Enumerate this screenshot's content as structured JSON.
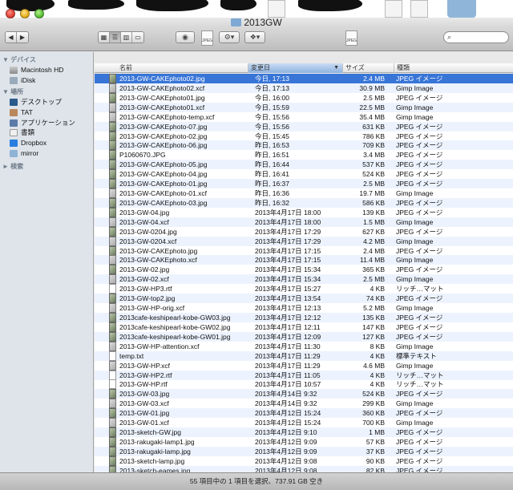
{
  "window": {
    "title": "2013GW"
  },
  "toolbar": {
    "back_icon": "back-arrow-icon",
    "forward_icon": "forward-arrow-icon",
    "view_modes": [
      "icon-view",
      "list-view",
      "column-view",
      "coverflow-view"
    ],
    "selected_view": "list-view",
    "doc_badge": "JPEG"
  },
  "sidebar": {
    "sections": [
      {
        "title": "▼ デバイス",
        "items": [
          {
            "label": "Macintosh HD",
            "icon": "hard-disk-icon"
          },
          {
            "label": "iDisk",
            "icon": "idisk-icon"
          }
        ]
      },
      {
        "title": "▼ 場所",
        "items": [
          {
            "label": "デスクトップ",
            "icon": "desktop-icon"
          },
          {
            "label": "TAT",
            "icon": "home-icon"
          },
          {
            "label": "アプリケーション",
            "icon": "applications-icon"
          },
          {
            "label": "書類",
            "icon": "documents-icon"
          },
          {
            "label": "Dropbox",
            "icon": "dropbox-icon"
          },
          {
            "label": "mirror",
            "icon": "folder-icon"
          }
        ]
      },
      {
        "title": "► 検索",
        "items": []
      }
    ]
  },
  "columns": {
    "name": "名前",
    "date": "変更日",
    "size": "サイズ",
    "kind": "種類",
    "sort_arrow": "▼"
  },
  "files": [
    {
      "name": "2013-GW-CAKEphoto02.jpg",
      "date": "今日, 17:13",
      "size": "2.4 MB",
      "kind": "JPEG イメージ",
      "type": "jpg",
      "selected": true
    },
    {
      "name": "2013-GW-CAKEphoto02.xcf",
      "date": "今日, 17:13",
      "size": "30.9 MB",
      "kind": "Gimp Image",
      "type": "xcf"
    },
    {
      "name": "2013-GW-CAKEphoto01.jpg",
      "date": "今日, 16:00",
      "size": "2.5 MB",
      "kind": "JPEG イメージ",
      "type": "jpg"
    },
    {
      "name": "2013-GW-CAKEphoto01.xcf",
      "date": "今日, 15:59",
      "size": "22.5 MB",
      "kind": "Gimp Image",
      "type": "xcf"
    },
    {
      "name": "2013-GW-CAKEphoto-temp.xcf",
      "date": "今日, 15:56",
      "size": "35.4 MB",
      "kind": "Gimp Image",
      "type": "xcf"
    },
    {
      "name": "2013-GW-CAKEphoto-07.jpg",
      "date": "今日, 15:56",
      "size": "631 KB",
      "kind": "JPEG イメージ",
      "type": "jpg"
    },
    {
      "name": "2013-GW-CAKEphoto-02.jpg",
      "date": "今日, 15:45",
      "size": "786 KB",
      "kind": "JPEG イメージ",
      "type": "jpg"
    },
    {
      "name": "2013-GW-CAKEphoto-06.jpg",
      "date": "昨日, 16:53",
      "size": "709 KB",
      "kind": "JPEG イメージ",
      "type": "jpg"
    },
    {
      "name": "P1060670.JPG",
      "date": "昨日, 16:51",
      "size": "3.4 MB",
      "kind": "JPEG イメージ",
      "type": "jpg"
    },
    {
      "name": "2013-GW-CAKEphoto-05.jpg",
      "date": "昨日, 16:44",
      "size": "537 KB",
      "kind": "JPEG イメージ",
      "type": "jpg"
    },
    {
      "name": "2013-GW-CAKEphoto-04.jpg",
      "date": "昨日, 16:41",
      "size": "524 KB",
      "kind": "JPEG イメージ",
      "type": "jpg"
    },
    {
      "name": "2013-GW-CAKEphoto-01.jpg",
      "date": "昨日, 16:37",
      "size": "2.5 MB",
      "kind": "JPEG イメージ",
      "type": "jpg"
    },
    {
      "name": "2013-GW-CAKEphoto-01.xcf",
      "date": "昨日, 16:36",
      "size": "19.7 MB",
      "kind": "Gimp Image",
      "type": "xcf"
    },
    {
      "name": "2013-GW-CAKEphoto-03.jpg",
      "date": "昨日, 16:32",
      "size": "586 KB",
      "kind": "JPEG イメージ",
      "type": "jpg"
    },
    {
      "name": "2013-GW-04.jpg",
      "date": "2013年4月17日 18:00",
      "size": "139 KB",
      "kind": "JPEG イメージ",
      "type": "jpg"
    },
    {
      "name": "2013-GW-04.xcf",
      "date": "2013年4月17日 18:00",
      "size": "1.5 MB",
      "kind": "Gimp Image",
      "type": "xcf"
    },
    {
      "name": "2013-GW-0204.jpg",
      "date": "2013年4月17日 17:29",
      "size": "627 KB",
      "kind": "JPEG イメージ",
      "type": "jpg"
    },
    {
      "name": "2013-GW-0204.xcf",
      "date": "2013年4月17日 17:29",
      "size": "4.2 MB",
      "kind": "Gimp Image",
      "type": "xcf"
    },
    {
      "name": "2013-GW-CAKEphoto.jpg",
      "date": "2013年4月17日 17:15",
      "size": "2.4 MB",
      "kind": "JPEG イメージ",
      "type": "jpg"
    },
    {
      "name": "2013-GW-CAKEphoto.xcf",
      "date": "2013年4月17日 17:15",
      "size": "11.4 MB",
      "kind": "Gimp Image",
      "type": "xcf"
    },
    {
      "name": "2013-GW-02.jpg",
      "date": "2013年4月17日 15:34",
      "size": "365 KB",
      "kind": "JPEG イメージ",
      "type": "jpg"
    },
    {
      "name": "2013-GW-02.xcf",
      "date": "2013年4月17日 15:34",
      "size": "2.5 MB",
      "kind": "Gimp Image",
      "type": "xcf"
    },
    {
      "name": "2013-GW-HP3.rtf",
      "date": "2013年4月17日 15:27",
      "size": "4 KB",
      "kind": "リッチ…マット",
      "type": "rtf"
    },
    {
      "name": "2013-GW-top2.jpg",
      "date": "2013年4月17日 13:54",
      "size": "74 KB",
      "kind": "JPEG イメージ",
      "type": "jpg"
    },
    {
      "name": "2013-GW-HP-orig.xcf",
      "date": "2013年4月17日 12:13",
      "size": "5.2 MB",
      "kind": "Gimp Image",
      "type": "xcf"
    },
    {
      "name": "2013cafe-keshipearl-kobe-GW03.jpg",
      "date": "2013年4月17日 12:12",
      "size": "135 KB",
      "kind": "JPEG イメージ",
      "type": "jpg"
    },
    {
      "name": "2013cafe-keshipearl-kobe-GW02.jpg",
      "date": "2013年4月17日 12:11",
      "size": "147 KB",
      "kind": "JPEG イメージ",
      "type": "jpg"
    },
    {
      "name": "2013cafe-keshipearl-kobe-GW01.jpg",
      "date": "2013年4月17日 12:09",
      "size": "127 KB",
      "kind": "JPEG イメージ",
      "type": "jpg"
    },
    {
      "name": "2013-GW-HP-attention.xcf",
      "date": "2013年4月17日 11:30",
      "size": "8 KB",
      "kind": "Gimp Image",
      "type": "xcf"
    },
    {
      "name": "temp.txt",
      "date": "2013年4月17日 11:29",
      "size": "4 KB",
      "kind": "標準テキスト",
      "type": "txt"
    },
    {
      "name": "2013-GW-HP.xcf",
      "date": "2013年4月17日 11:29",
      "size": "4.6 MB",
      "kind": "Gimp Image",
      "type": "xcf"
    },
    {
      "name": "2013-GW-HP2.rtf",
      "date": "2013年4月17日 11:05",
      "size": "4 KB",
      "kind": "リッチ…マット",
      "type": "rtf"
    },
    {
      "name": "2013-GW-HP.rtf",
      "date": "2013年4月17日 10:57",
      "size": "4 KB",
      "kind": "リッチ…マット",
      "type": "rtf"
    },
    {
      "name": "2013-GW-03.jpg",
      "date": "2013年4月14日 9:32",
      "size": "524 KB",
      "kind": "JPEG イメージ",
      "type": "jpg"
    },
    {
      "name": "2013-GW-03.xcf",
      "date": "2013年4月14日 9:32",
      "size": "299 KB",
      "kind": "Gimp Image",
      "type": "xcf"
    },
    {
      "name": "2013-GW-01.jpg",
      "date": "2013年4月12日 15:24",
      "size": "360 KB",
      "kind": "JPEG イメージ",
      "type": "jpg"
    },
    {
      "name": "2013-GW-01.xcf",
      "date": "2013年4月12日 15:24",
      "size": "700 KB",
      "kind": "Gimp Image",
      "type": "xcf"
    },
    {
      "name": "2013-sketch-GW.jpg",
      "date": "2013年4月12日 9:10",
      "size": "1 MB",
      "kind": "JPEG イメージ",
      "type": "jpg"
    },
    {
      "name": "2013-rakugaki-lamp1.jpg",
      "date": "2013年4月12日 9:09",
      "size": "57 KB",
      "kind": "JPEG イメージ",
      "type": "jpg"
    },
    {
      "name": "2013-rakugaki-lamp.jpg",
      "date": "2013年4月12日 9:09",
      "size": "37 KB",
      "kind": "JPEG イメージ",
      "type": "jpg"
    },
    {
      "name": "2013-sketch-lamp.jpg",
      "date": "2013年4月12日 9:08",
      "size": "90 KB",
      "kind": "JPEG イメージ",
      "type": "jpg"
    },
    {
      "name": "2013-sketch-eames.jpg",
      "date": "2013年4月12日 9:08",
      "size": "82 KB",
      "kind": "JPEG イメージ",
      "type": "jpg"
    }
  ],
  "statusbar": {
    "text": "55 項目中の 1 項目を選択、737.91 GB 空き"
  }
}
